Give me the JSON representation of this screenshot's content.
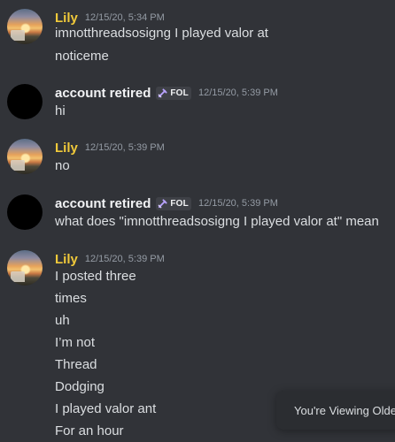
{
  "colors": {
    "background": "#313338",
    "lily_name": "#f0c93a",
    "account_name": "#f2f3f5",
    "message_text": "#dbdee1",
    "timestamp": "#949ba4"
  },
  "messages": [
    {
      "author": "Lily",
      "timestamp": "12/15/20, 5:34 PM",
      "lines": [
        "imnotthreadsosigng I played valor at",
        "noticeme"
      ]
    },
    {
      "author": "account retired",
      "tag": "FOL",
      "tag_icon": "sword-icon",
      "timestamp": "12/15/20, 5:39 PM",
      "lines": [
        "hi"
      ]
    },
    {
      "author": "Lily",
      "timestamp": "12/15/20, 5:39 PM",
      "lines": [
        "no"
      ]
    },
    {
      "author": "account retired",
      "tag": "FOL",
      "tag_icon": "sword-icon",
      "timestamp": "12/15/20, 5:39 PM",
      "lines": [
        "what does \"imnotthreadsosigng I played valor at\" mean"
      ]
    },
    {
      "author": "Lily",
      "timestamp": "12/15/20, 5:39 PM",
      "lines": [
        "I posted three",
        "times",
        "uh",
        "I’m not",
        "Thread",
        "Dodging",
        "I played valor ant",
        "For an hour"
      ]
    }
  ],
  "toast": {
    "label": "You're Viewing Older Messages"
  }
}
